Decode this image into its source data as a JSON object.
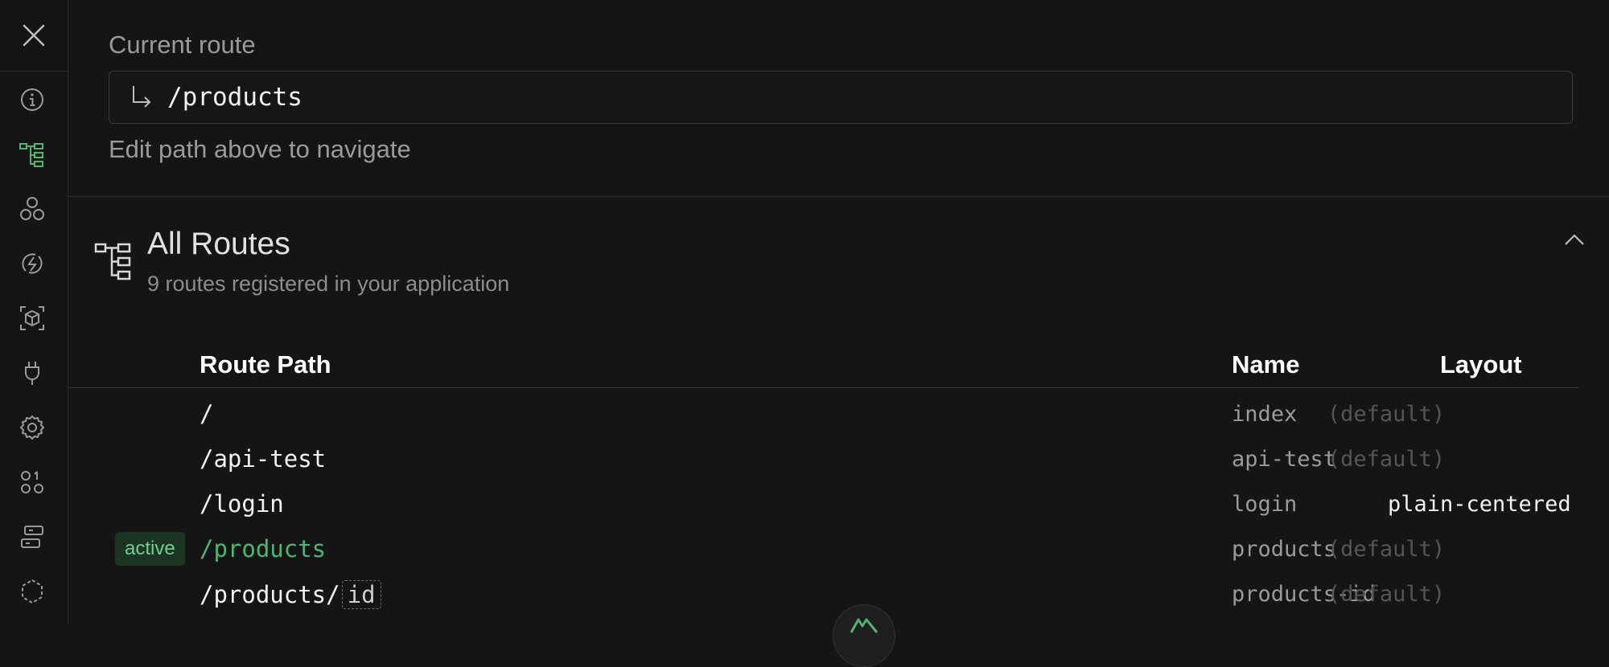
{
  "sidebar": {
    "icons": [
      "close-icon",
      "info-icon",
      "route-tree-icon",
      "components-icon",
      "lightning-icon",
      "assets-icon",
      "plug-icon",
      "settings-icon",
      "modules-icon",
      "server-routes-icon",
      "polygon-icon"
    ],
    "active": "route-tree-icon",
    "accent": "#4cb771"
  },
  "current_route": {
    "label": "Current route",
    "value": "/products",
    "hint": "Edit path above to navigate"
  },
  "all_routes": {
    "title": "All Routes",
    "subtitle": "9 routes registered in your application",
    "headers": {
      "path": "Route Path",
      "name": "Name",
      "layout": "Layout"
    },
    "rows": [
      {
        "path": "/",
        "name": "index",
        "layout": "(default)",
        "active": false
      },
      {
        "path": "/api-test",
        "name": "api-test",
        "layout": "(default)",
        "active": false
      },
      {
        "path": "/login",
        "name": "login",
        "layout": "plain-centered",
        "active": false
      },
      {
        "path": "/products",
        "name": "products",
        "layout": "(default)",
        "active": true,
        "badge": "active"
      },
      {
        "path_prefix": "/products/",
        "param": "id",
        "name": "products-id",
        "layout": "(default)",
        "active": false
      }
    ]
  }
}
